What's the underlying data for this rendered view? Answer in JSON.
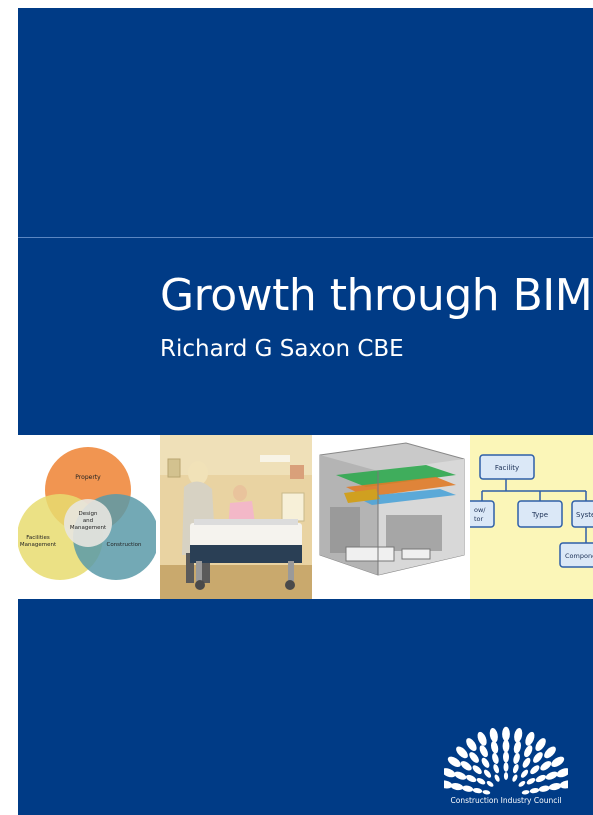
{
  "cover": {
    "title": "Growth through BIM",
    "author": "Richard G Saxon CBE"
  },
  "venn": {
    "top": "Property",
    "center_line1": "Design",
    "center_line2": "and",
    "center_line3": "Management",
    "left_line1": "Facilities",
    "left_line2": "Management",
    "right": "Construction"
  },
  "hierarchy": {
    "root": "Facility",
    "left": "ow/",
    "left2": "tor",
    "middle": "Type",
    "right": "System",
    "bottom": "Component"
  },
  "logo": {
    "org_name": "Construction Industry Council"
  },
  "colors": {
    "cover_blue": "#003b86",
    "venn_orange": "#f08a3e",
    "venn_yellow": "#e8dc70",
    "venn_teal": "#5b9aa8",
    "chart_bg": "#fbf6b8",
    "chart_box": "#dbe8f7",
    "chart_border": "#2e5fa8"
  }
}
